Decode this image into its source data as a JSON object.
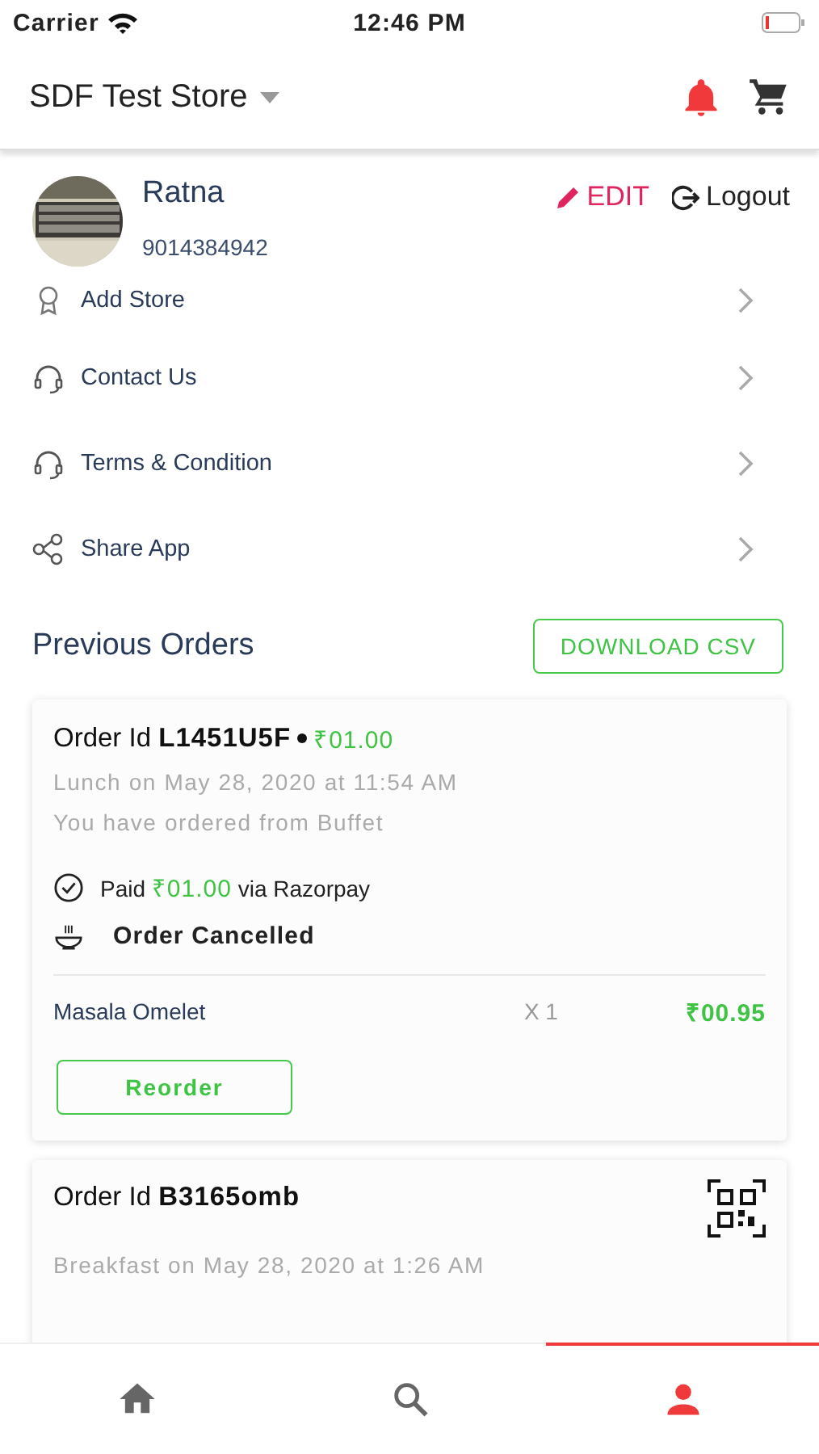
{
  "status_bar": {
    "carrier": "Carrier",
    "time": "12:46 PM"
  },
  "header": {
    "store_name": "SDF Test Store"
  },
  "profile": {
    "name": "Ratna",
    "phone": "9014384942",
    "edit_label": "EDIT",
    "logout_label": "Logout"
  },
  "menu": [
    {
      "label": "Add Store",
      "kind": "pin"
    },
    {
      "label": "Contact Us",
      "kind": "headset"
    },
    {
      "label": "Terms & Condition",
      "kind": "headset"
    },
    {
      "label": "Share App",
      "kind": "share"
    }
  ],
  "orders_section": {
    "title": "Previous Orders",
    "download_label": "DOWNLOAD CSV"
  },
  "orders": [
    {
      "order_label": "Order Id",
      "order_id": "L1451U5F",
      "amount": "₹01.00",
      "meal_time": "Lunch on May 28, 2020 at 11:54 AM",
      "from_text": "You have ordered from Buffet",
      "payment": {
        "prefix": "Paid",
        "amount": "₹01.00",
        "suffix": "via Razorpay"
      },
      "status": "Order Cancelled",
      "items": [
        {
          "name": "Masala Omelet",
          "qty": "X 1",
          "price": "₹00.95"
        }
      ],
      "reorder_label": "Reorder",
      "qr": false
    },
    {
      "order_label": "Order Id",
      "order_id": "B3165omb",
      "meal_time": "Breakfast on May 28, 2020 at 1:26 AM",
      "qr": true
    }
  ],
  "nav": [
    {
      "kind": "home",
      "selected": false
    },
    {
      "kind": "search",
      "selected": false
    },
    {
      "kind": "profile",
      "selected": true
    }
  ]
}
